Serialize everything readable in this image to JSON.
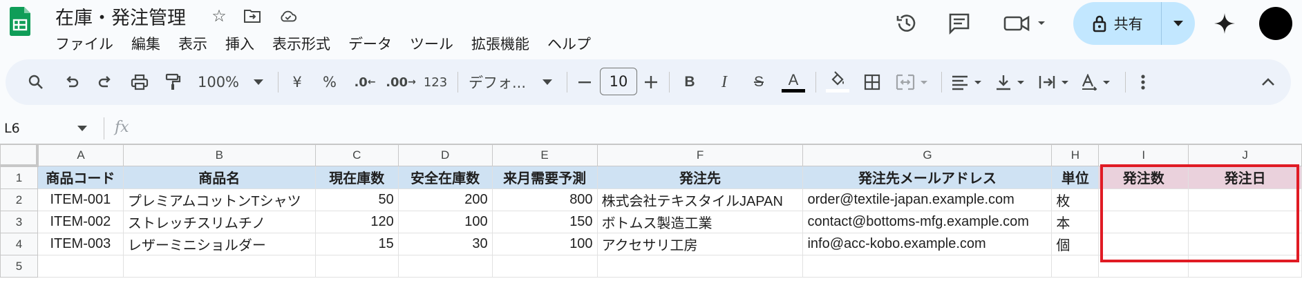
{
  "app": {
    "title": "在庫・発注管理",
    "menu": [
      "ファイル",
      "編集",
      "表示",
      "挿入",
      "表示形式",
      "データ",
      "ツール",
      "拡張機能",
      "ヘルプ"
    ],
    "share_label": "共有"
  },
  "toolbar": {
    "zoom": "100%",
    "currency": "¥",
    "percent": "%",
    "dec_decrease": ".0",
    "dec_increase": ".00",
    "number_format": "123",
    "font": "デフォ...",
    "font_size": "10",
    "bold": "B",
    "italic": "I",
    "strike": "S",
    "text_color": "A"
  },
  "formula_bar": {
    "cell_ref": "L6",
    "fx": "fx",
    "value": ""
  },
  "sheet": {
    "columns": [
      "A",
      "B",
      "C",
      "D",
      "E",
      "F",
      "G",
      "H",
      "I",
      "J"
    ],
    "rows": [
      "1",
      "2",
      "3",
      "4",
      "5"
    ],
    "headers": [
      "商品コード",
      "商品名",
      "現在庫数",
      "安全在庫数",
      "来月需要予測",
      "発注先",
      "発注先メールアドレス",
      "単位",
      "発注数",
      "発注日"
    ],
    "data": [
      [
        "ITEM-001",
        "プレミアムコットンTシャツ",
        "50",
        "200",
        "800",
        "株式会社テキスタイルJAPAN",
        "order@textile-japan.example.com",
        "枚",
        "",
        ""
      ],
      [
        "ITEM-002",
        "ストレッチスリムチノ",
        "120",
        "100",
        "150",
        "ボトムス製造工業",
        "contact@bottoms-mfg.example.com",
        "本",
        "",
        ""
      ],
      [
        "ITEM-003",
        "レザーミニショルダー",
        "15",
        "30",
        "100",
        "アクセサリ工房",
        "info@acc-kobo.example.com",
        "個",
        "",
        ""
      ]
    ]
  },
  "colors": {
    "header_blue": "#cfe2f3",
    "header_pink": "#ead1dc",
    "highlight_red": "#e01b24",
    "share_bg": "#c2e7ff",
    "sheets_green": "#0f9d58"
  }
}
